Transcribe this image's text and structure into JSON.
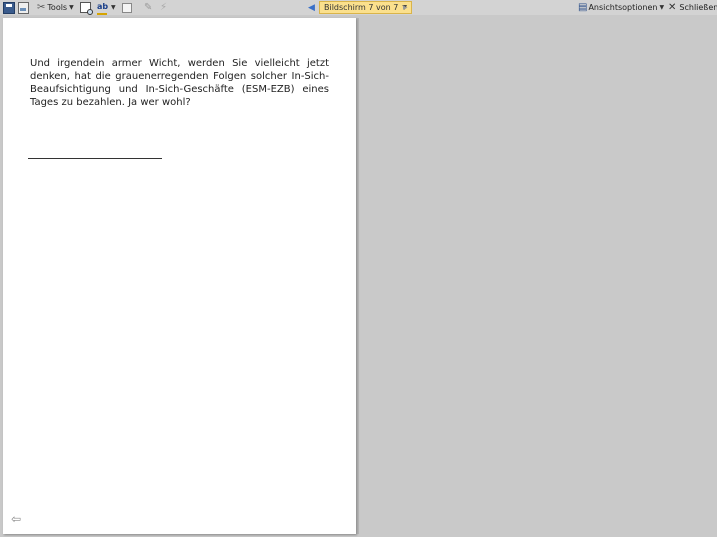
{
  "toolbar": {
    "tools_label": "Tools",
    "screen_indicator": "Bildschirm 7 von 7",
    "view_options_label": "Ansichtsoptionen",
    "close_label": "Schließen"
  },
  "page": {
    "paragraph": "Und irgendein armer Wicht, werden Sie vielleicht jetzt denken, hat die grauenerregenden Folgen solcher In-Sich-Beaufsichtigung und In-Sich-Geschäfte (ESM-EZB) eines Tages zu bezahlen. Ja wer wohl?"
  },
  "icons": [
    "save-icon",
    "print-preview-icon",
    "tools-icon",
    "research-icon",
    "spelling-icon",
    "comment-icon",
    "pen-icon",
    "highlighter-icon",
    "previous-screen-icon",
    "next-screen-icon",
    "view-options-icon",
    "close-icon",
    "back-arrow-icon"
  ]
}
